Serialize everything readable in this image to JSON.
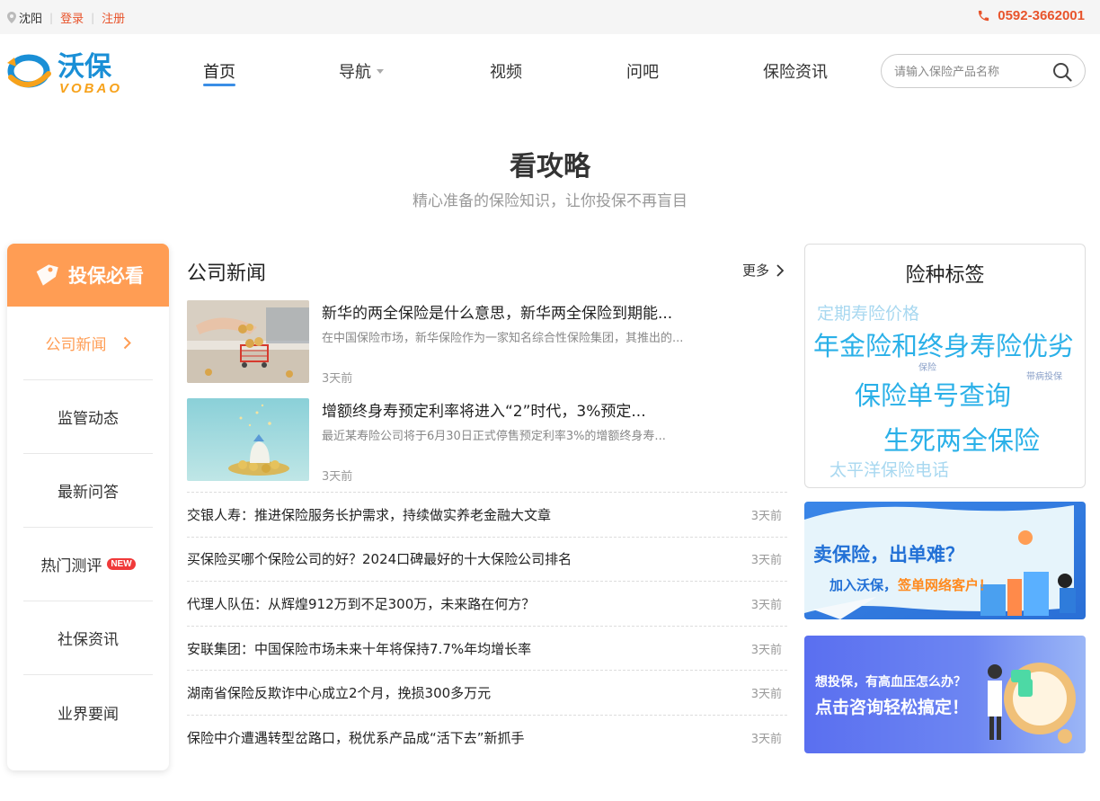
{
  "topbar": {
    "city": "沈阳",
    "login": "登录",
    "register": "注册",
    "phone": "0592-3662001"
  },
  "logo": {
    "cn": "沃保",
    "en": "VOBAO"
  },
  "nav": {
    "items": [
      {
        "label": "首页",
        "active": true
      },
      {
        "label": "导航",
        "dropdown": true
      },
      {
        "label": "视频"
      },
      {
        "label": "问吧"
      },
      {
        "label": "保险资讯"
      }
    ]
  },
  "search": {
    "placeholder": "请输入保险产品名称"
  },
  "section": {
    "title": "看攻略",
    "subtitle": "精心准备的保险知识，让你投保不再盲目"
  },
  "sidebar": {
    "header": "投保必看",
    "items": [
      {
        "label": "公司新闻",
        "active": true
      },
      {
        "label": "监管动态"
      },
      {
        "label": "最新问答"
      },
      {
        "label": "热门测评",
        "badge": "NEW"
      },
      {
        "label": "社保资讯"
      },
      {
        "label": "业界要闻"
      }
    ]
  },
  "news": {
    "title": "公司新闻",
    "more": "更多",
    "features": [
      {
        "title": "新华的两全保险是什么意思，新华两全保险到期能...",
        "desc": "在中国保险市场，新华保险作为一家知名综合性保险集团，其推出的...",
        "time": "3天前"
      },
      {
        "title": "增额终身寿预定利率将进入“2”时代，3%预定...",
        "desc": "最近某寿险公司将于6月30日正式停售预定利率3%的增额终身寿...",
        "time": "3天前"
      }
    ],
    "list": [
      {
        "title": "交银人寿：推进保险服务长护需求，持续做实养老金融大文章",
        "time": "3天前"
      },
      {
        "title": "买保险买哪个保险公司的好？2024口碑最好的十大保险公司排名",
        "time": "3天前"
      },
      {
        "title": "代理人队伍：从辉煌912万到不足300万，未来路在何方？",
        "time": "3天前"
      },
      {
        "title": "安联集团：中国保险市场未来十年将保持7.7%年均增长率",
        "time": "3天前"
      },
      {
        "title": "湖南省保险反欺诈中心成立2个月，挽损300多万元",
        "time": "3天前"
      },
      {
        "title": "保险中介遭遇转型岔路口，税优系产品成“活下去”新抓手",
        "time": "3天前"
      }
    ]
  },
  "tags": {
    "title": "险种标签",
    "items": [
      {
        "label": "定期寿险价格",
        "color": "#a8d8f0"
      },
      {
        "label": "年金险和终身寿险优劣",
        "color": "#2ab0e8"
      },
      {
        "label": "保险",
        "color": "#8aa0c8"
      },
      {
        "label": "带病投保",
        "color": "#8aa0c8"
      },
      {
        "label": "保险单号查询",
        "color": "#2ab0e8"
      },
      {
        "label": "生死两全保险",
        "color": "#2ab0e8"
      },
      {
        "label": "太平洋保险电话",
        "color": "#a8d8f0"
      }
    ]
  },
  "banners": [
    {
      "line1": "卖保险，出单难？",
      "line2a": "加入沃保，",
      "line2b": "签单网络客户！"
    },
    {
      "line1": "想投保，有高血压怎么办？",
      "line2": "点击咨询轻松搞定！"
    }
  ],
  "colors": {
    "accent_orange": "#ff9d54",
    "brand_red": "#e8542c",
    "nav_underline": "#3a8ee6",
    "badge_red": "#f03a3a"
  }
}
